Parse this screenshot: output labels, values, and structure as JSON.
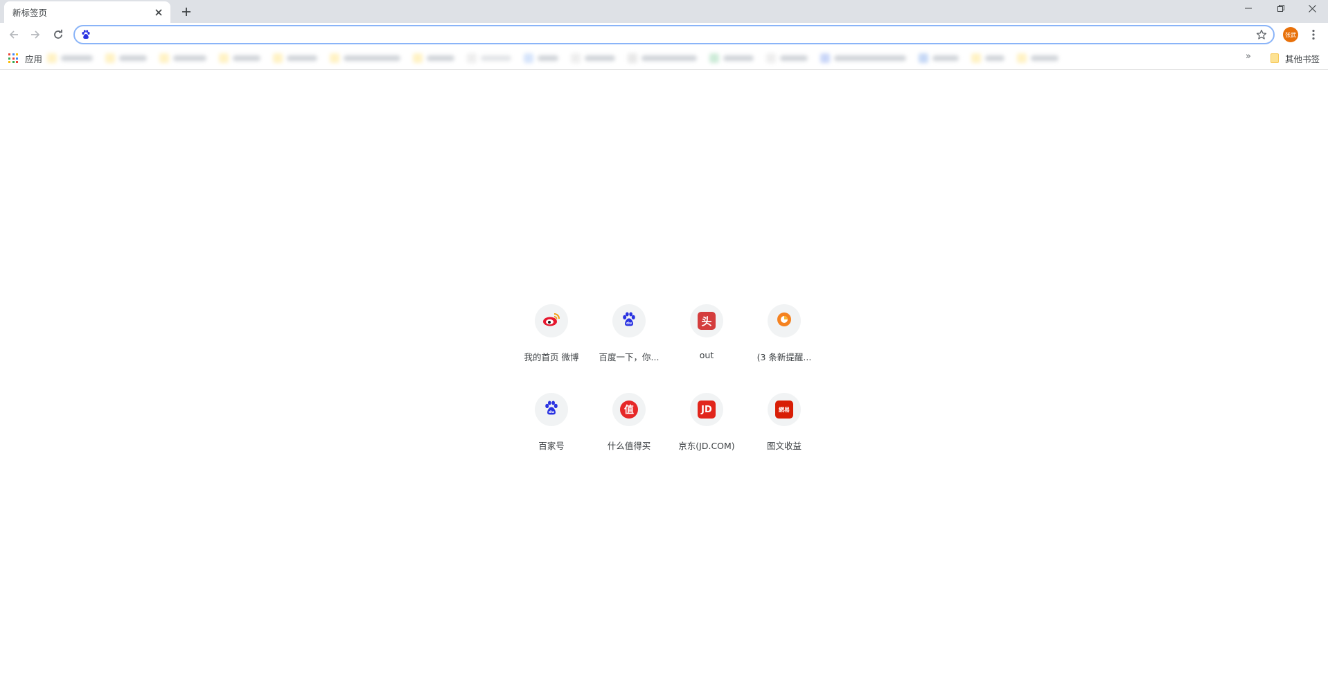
{
  "colors": {
    "tab_strip": "#dee1e6",
    "omnibox_border": "#8ab4f8",
    "profile_bg": "#e8710a",
    "baidu_blue": "#2932e1",
    "weibo_red": "#e6162d",
    "toutiao_red": "#d43d3d",
    "jd_red": "#e1251b",
    "zhide_red": "#e62828",
    "netease_red": "#d81e06"
  },
  "tab": {
    "title": "新标签页",
    "close_icon": "close-icon"
  },
  "window": {
    "minimize_icon": "minimize-icon",
    "maximize_icon": "restore-icon",
    "close_icon": "close-icon"
  },
  "omnibox": {
    "value": "",
    "placeholder": "",
    "site_icon": "baidu-paw-icon"
  },
  "profile": {
    "label": "张武"
  },
  "bookmarks_bar": {
    "apps_label": "应用",
    "more_label": "»",
    "other_bookmarks_label": "其他书签"
  },
  "most_visited": [
    {
      "label": "我的首页 微博",
      "icon": "weibo-icon"
    },
    {
      "label": "百度一下，你...",
      "icon": "baidu-icon"
    },
    {
      "label": "out",
      "icon": "toutiao-icon",
      "glyph": "头"
    },
    {
      "label": "(3 条新提醒...",
      "icon": "sohu-icon"
    },
    {
      "label": "百家号",
      "icon": "baidu-icon"
    },
    {
      "label": "什么值得买",
      "icon": "zhide-icon",
      "glyph": "值"
    },
    {
      "label": "京东(JD.COM)",
      "icon": "jd-icon",
      "glyph": "JD"
    },
    {
      "label": "图文收益",
      "icon": "netease-icon",
      "glyph": "網易"
    }
  ]
}
